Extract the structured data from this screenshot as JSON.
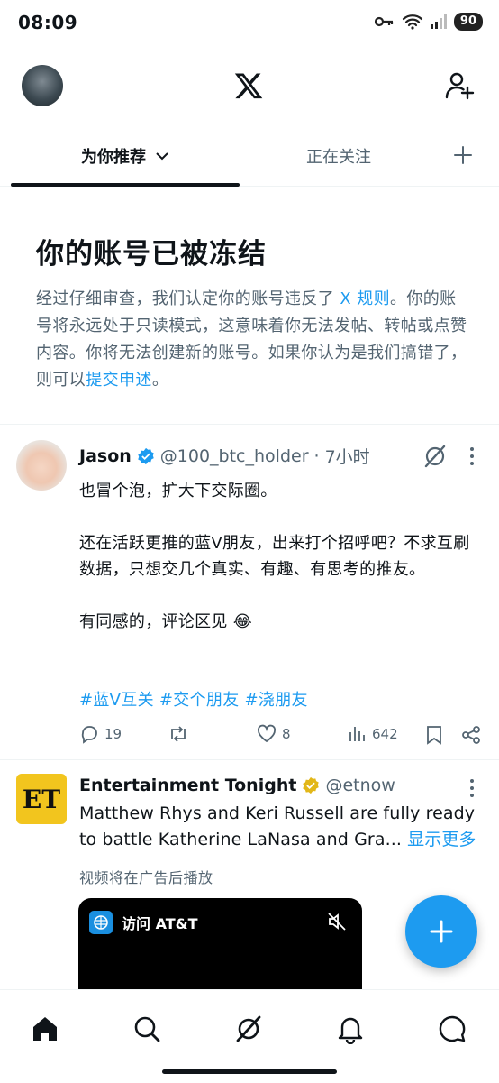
{
  "status_bar": {
    "time": "08:09",
    "battery": "90"
  },
  "tabs": [
    {
      "label": "为你推荐"
    },
    {
      "label": "正在关注"
    }
  ],
  "notice": {
    "title": "你的账号已被冻结",
    "text_1": "经过仔细审查，我们认定你的账号违反了 ",
    "link_rules": "X 规则",
    "text_2": "。你的账号将永远处于只读模式，这意味着你无法发帖、转帖或点赞内容。你将无法创建新的账号。如果你认为是我们搞错了，则可以",
    "link_appeal": "提交申述",
    "text_3": "。"
  },
  "tweet": {
    "name": "Jason",
    "handle": "@100_btc_holder",
    "dot": "·",
    "time": "7小时",
    "lines": [
      "也冒个泡，扩大下交际圈。",
      "",
      "还在活跃更推的蓝V朋友，出来打个招呼吧？不求互刷数据，只想交几个真实、有趣、有思考的推友。",
      "",
      "有同感的，评论区见 😂"
    ],
    "hashtags": "#蓝V互关 #交个朋友 #浇朋友",
    "replies": "19",
    "likes": "8",
    "views": "642"
  },
  "ad": {
    "logo": "ET",
    "name": "Entertainment Tonight",
    "handle": "@etnow",
    "line1": "Matthew Rhys and Keri Russell are fully ready",
    "line2": "to battle Katherine LaNasa and Gra...",
    "show_more": "显示更多",
    "note": "视频将在广告后播放",
    "visit": "访问 AT&T"
  },
  "colors": {
    "accent": "#1d9bf0",
    "text": "#0f1419",
    "muted": "#536471",
    "verified_gold": "#e2b719"
  }
}
